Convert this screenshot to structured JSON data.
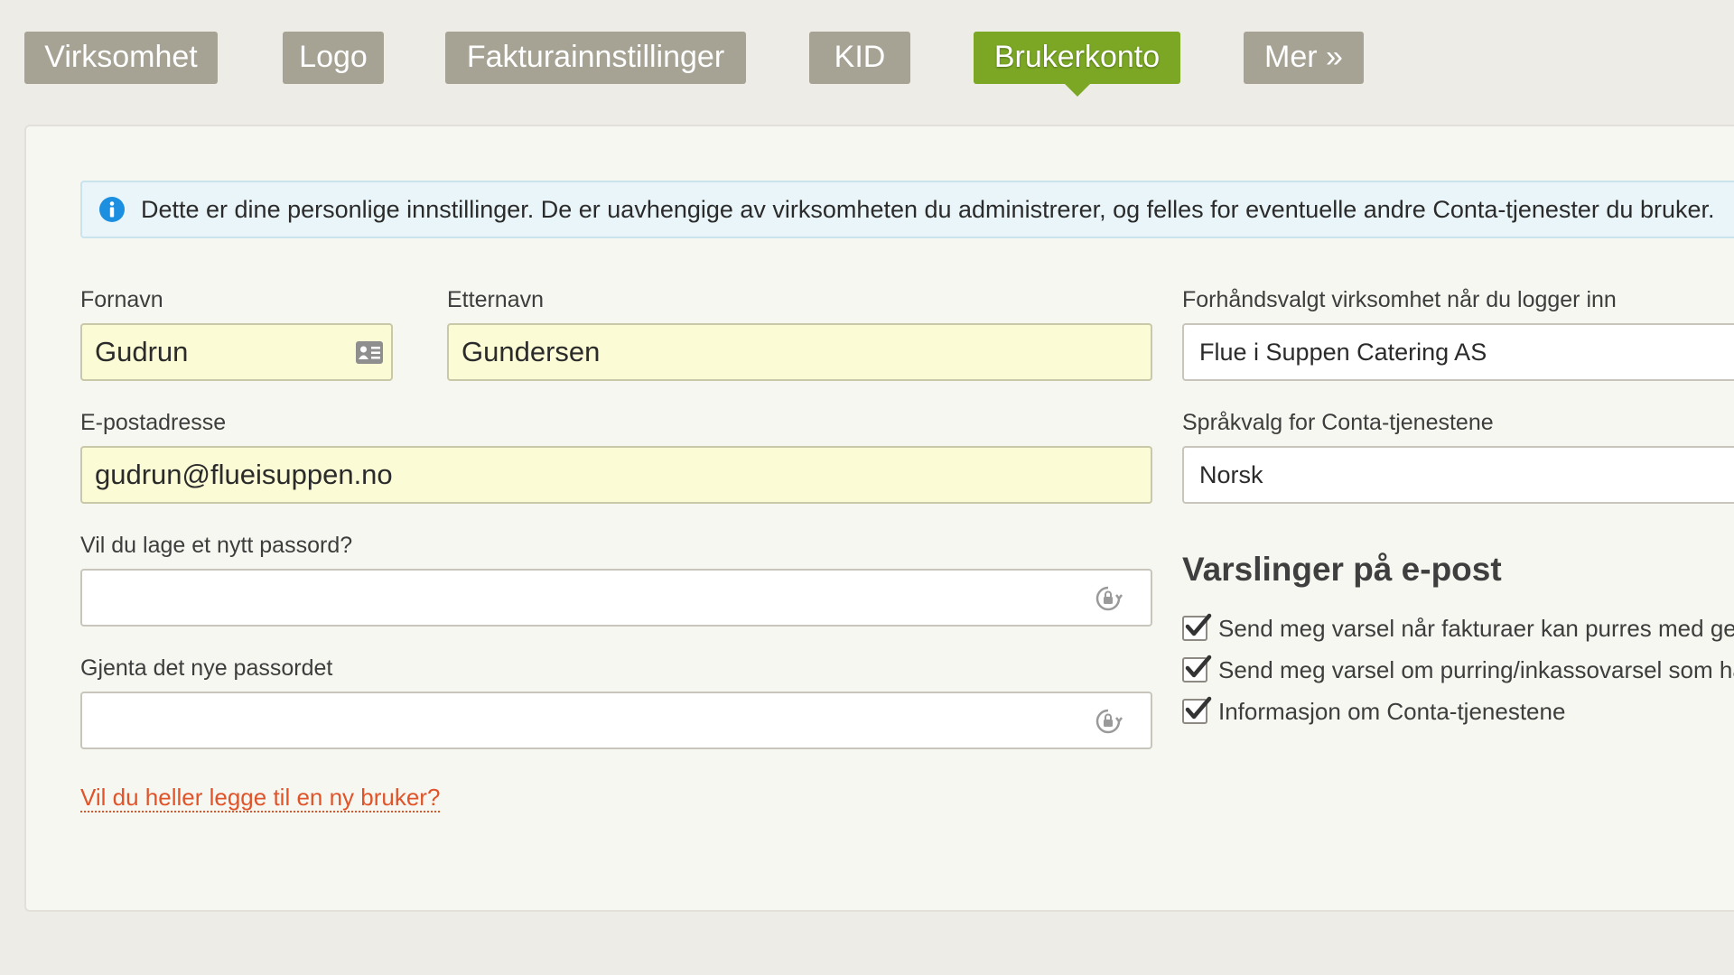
{
  "tabs": [
    {
      "label": "Virksomhet",
      "active": false
    },
    {
      "label": "Logo",
      "active": false
    },
    {
      "label": "Fakturainnstillinger",
      "active": false
    },
    {
      "label": "KID",
      "active": false
    },
    {
      "label": "Brukerkonto",
      "active": true
    },
    {
      "label": "Mer »",
      "active": false
    }
  ],
  "info": {
    "icon": "info-icon",
    "text": "Dette er dine personlige innstillinger. De er uavhengige av virksomheten du administrerer, og felles for eventuelle andre Conta-tjenester du bruker."
  },
  "form": {
    "first_name_label": "Fornavn",
    "first_name_value": "Gudrun",
    "last_name_label": "Etternavn",
    "last_name_value": "Gundersen",
    "email_label": "E-postadresse",
    "email_value": "gudrun@flueisuppen.no",
    "new_password_label": "Vil du lage et nytt passord?",
    "new_password_value": "",
    "repeat_password_label": "Gjenta det nye passordet",
    "repeat_password_value": "",
    "add_user_link": "Vil du heller legge til en ny bruker?"
  },
  "preferences": {
    "default_company_label": "Forhåndsvalgt virksomhet når du logger inn",
    "default_company_value": "Flue i Suppen Catering AS",
    "language_label": "Språkvalg for Conta-tjenestene",
    "language_value": "Norsk"
  },
  "notifications": {
    "heading": "Varslinger på e-post",
    "items": [
      {
        "label": "Send meg varsel når fakturaer kan purres med gebyr",
        "checked": true
      },
      {
        "label": "Send meg varsel om purring/inkassovarsel som har",
        "checked": true
      },
      {
        "label": "Informasjon om Conta-tjenestene",
        "checked": true
      }
    ]
  },
  "colors": {
    "tab_inactive": "#a6a395",
    "tab_active": "#7ba725",
    "autofill_yellow": "#fbfbd6",
    "link": "#e0542a",
    "info_blue": "#1d8fe0"
  }
}
